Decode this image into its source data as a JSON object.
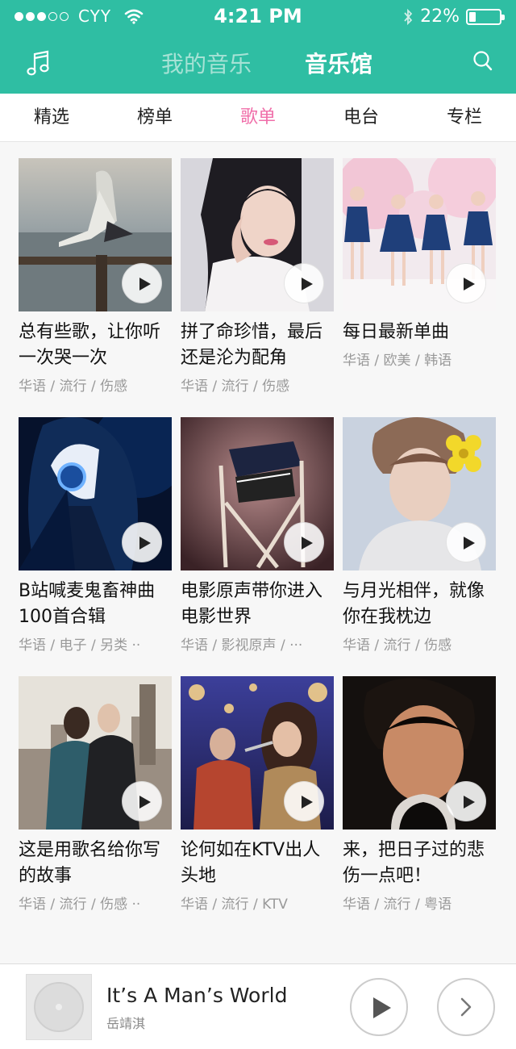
{
  "status_bar": {
    "carrier": "CYY",
    "time": "4:21 PM",
    "battery": "22%",
    "battery_level": 0.22,
    "signal_filled": 3,
    "signal_total": 5
  },
  "header": {
    "left_icon": "music-note-icon",
    "tabs": [
      {
        "label": "我的音乐",
        "active": false
      },
      {
        "label": "音乐馆",
        "active": true
      }
    ],
    "right_icon": "search-icon",
    "background": "#2fbea3"
  },
  "sub_tabs": [
    {
      "label": "精选",
      "active": false
    },
    {
      "label": "榜单",
      "active": false
    },
    {
      "label": "歌单",
      "active": true
    },
    {
      "label": "电台",
      "active": false
    },
    {
      "label": "专栏",
      "active": false
    }
  ],
  "accent_color": "#f06ea9",
  "playlists": [
    {
      "title": "总有些歌，让你听一次哭一次",
      "tags": "华语 / 流行 / 伤感"
    },
    {
      "title": "拼了命珍惜，最后还是沦为配角",
      "tags": "华语 / 流行 / 伤感"
    },
    {
      "title": "每日最新单曲",
      "tags": "华语 / 欧美 / 韩语"
    },
    {
      "title": "B站喊麦鬼畜神曲100首合辑",
      "tags": "华语 / 电子 / 另类 ··"
    },
    {
      "title": "电影原声带你进入电影世界",
      "tags": "华语 / 影视原声 / ···"
    },
    {
      "title": "与月光相伴，就像你在我枕边",
      "tags": "华语 / 流行 / 伤感"
    },
    {
      "title": "这是用歌名给你写的故事",
      "tags": "华语 / 流行 / 伤感 ··"
    },
    {
      "title": "论何如在KTV出人头地",
      "tags": "华语 / 流行 / KTV"
    },
    {
      "title": "来，把日子过的悲伤一点吧！",
      "tags": "华语 / 流行 / 粤语"
    }
  ],
  "player": {
    "song_title": "It’s  A Man’s World",
    "artist": "岳靖淇",
    "play_icon": "play-icon",
    "next_icon": "chevron-right-icon"
  }
}
